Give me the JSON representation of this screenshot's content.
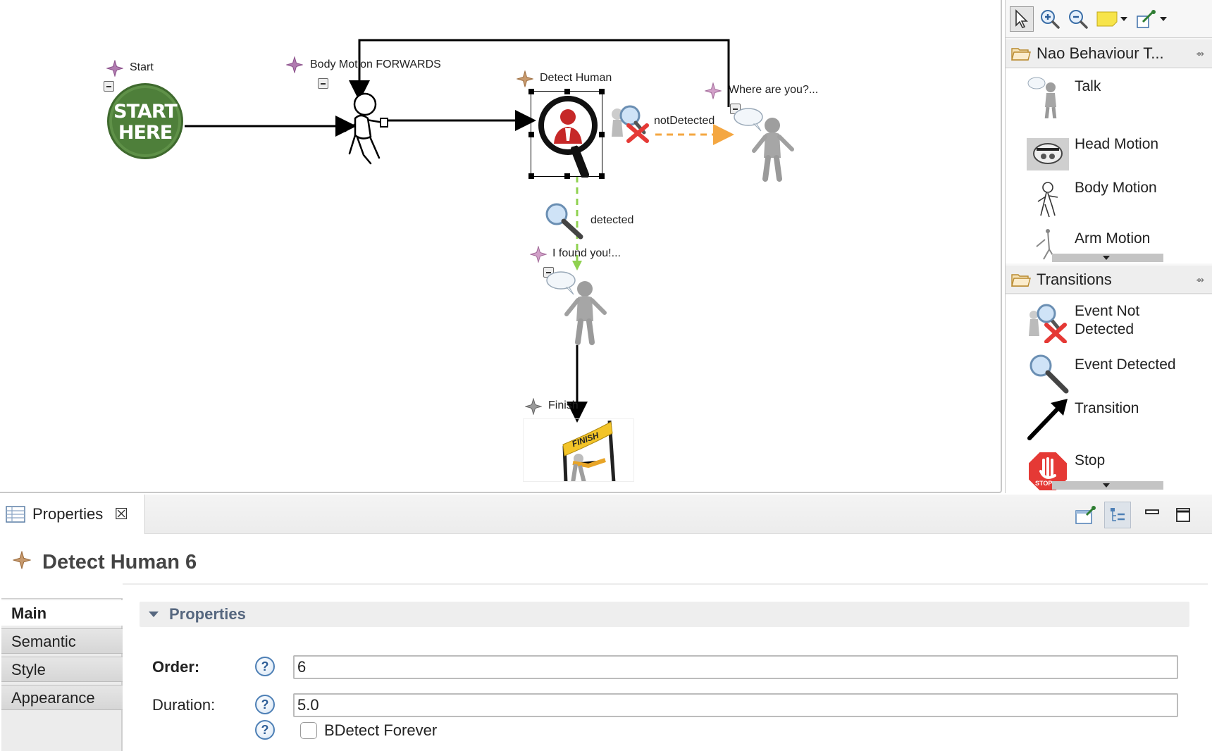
{
  "diagram": {
    "nodes": {
      "start": {
        "label": "Start",
        "badge_line1": "START",
        "badge_line2": "HERE"
      },
      "body_motion": {
        "label": "Body Motion FORWARDS"
      },
      "detect_human": {
        "label": "Detect Human"
      },
      "where_are_you": {
        "label": "Where are you?..."
      },
      "found_you": {
        "label": "I found you!..."
      },
      "finish": {
        "label": "Finish",
        "banner_text": "FINISH"
      }
    },
    "transitions": {
      "not_detected": "notDetected",
      "detected": "detected"
    }
  },
  "palette": {
    "drawers": [
      {
        "title": "Nao Behaviour T...",
        "items": [
          {
            "label": "Talk",
            "icon": "talk-icon"
          },
          {
            "label": "Head Motion",
            "icon": "head-motion-icon"
          },
          {
            "label": "Body Motion",
            "icon": "body-motion-icon"
          },
          {
            "label": "Arm Motion",
            "icon": "arm-motion-icon"
          }
        ]
      },
      {
        "title": "Transitions",
        "items": [
          {
            "label": "Event Not Detected",
            "icon": "event-not-detected-icon"
          },
          {
            "label": "Event Detected",
            "icon": "event-detected-icon"
          },
          {
            "label": "Transition",
            "icon": "transition-arrow-icon"
          },
          {
            "label": "Stop",
            "icon": "stop-sign-icon",
            "sign_text": "STOP"
          }
        ]
      }
    ]
  },
  "properties_view": {
    "tab_title": "Properties",
    "element_title": "Detect Human 6",
    "tabs": [
      "Main",
      "Semantic",
      "Style",
      "Appearance"
    ],
    "selected_tab": "Main",
    "section_title": "Properties",
    "fields": {
      "order": {
        "label": "Order:",
        "value": "6"
      },
      "duration": {
        "label": "Duration:",
        "value": "5.0"
      },
      "detect_forever": {
        "label": "BDetect Forever",
        "checked": false
      }
    },
    "help_glyph": "?"
  },
  "colors": {
    "start_badge": "#4e7f3a",
    "detect_red": "#c62828",
    "not_detected_line": "#f4a742",
    "detected_line": "#8fd14f",
    "section_title": "#56677f",
    "star_purple": "#9b5f9b"
  }
}
